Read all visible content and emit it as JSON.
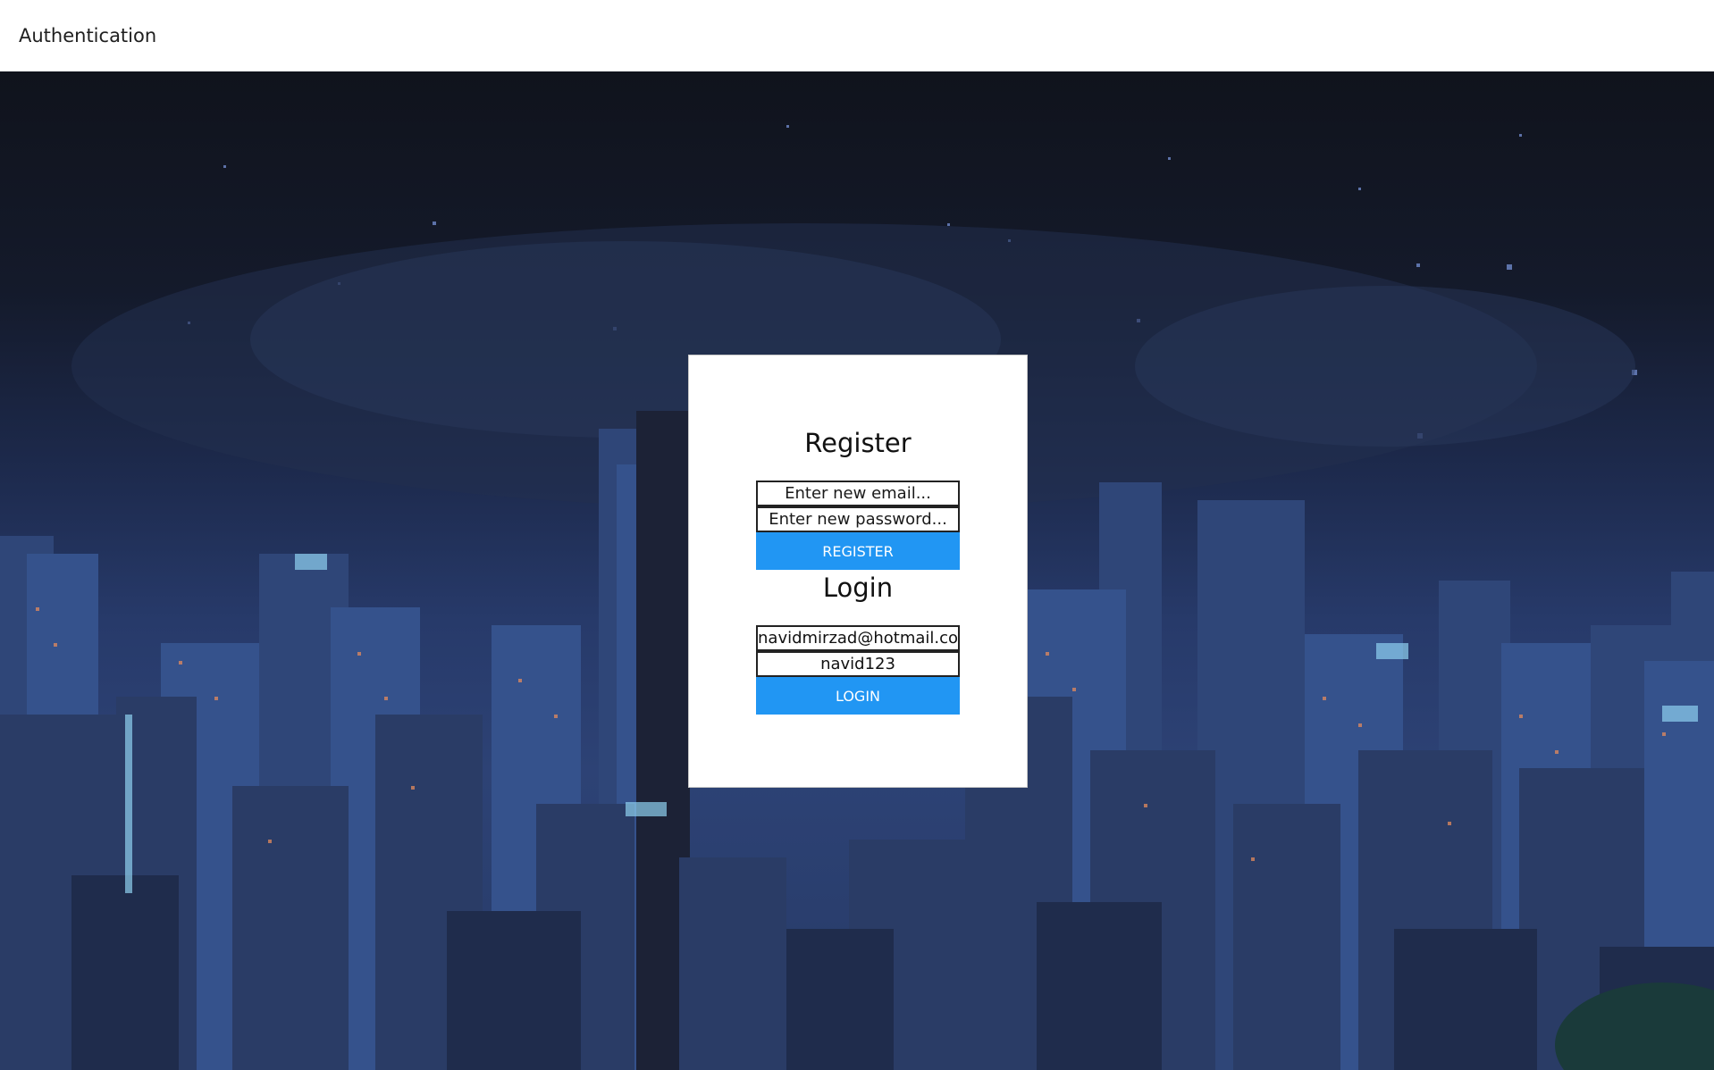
{
  "header": {
    "title": "Authentication"
  },
  "register": {
    "heading": "Register",
    "email_placeholder": "Enter new email...",
    "password_placeholder": "Enter new password...",
    "button_label": "REGISTER"
  },
  "login": {
    "heading": "Login",
    "email_value": "navidmirzad@hotmail.com",
    "password_value": "navid123",
    "button_label": "LOGIN"
  },
  "colors": {
    "button": "#2196f3",
    "card": "#ffffff",
    "sky": "#10131c"
  }
}
